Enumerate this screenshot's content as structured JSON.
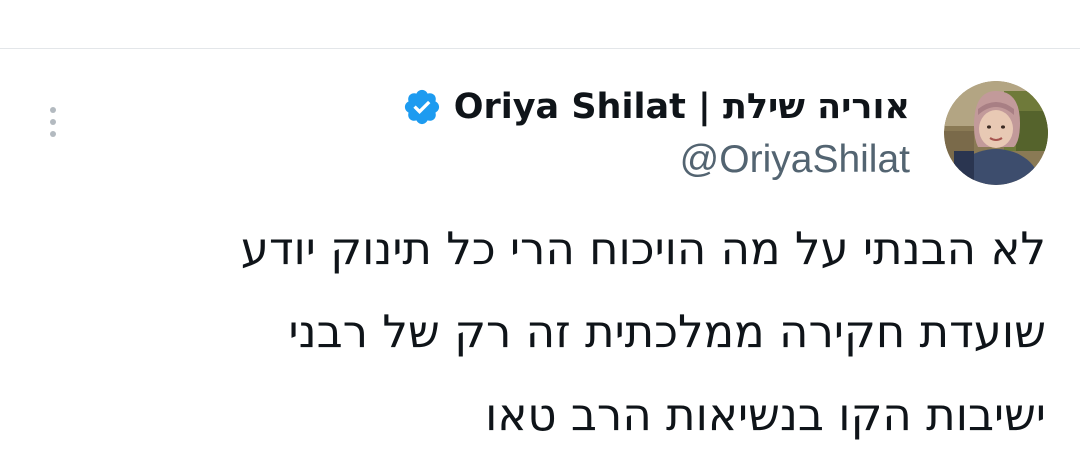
{
  "tweet": {
    "author": {
      "display_name": "אוריה שילת | Oriya Shilat",
      "handle": "@OriyaShilat",
      "verified": true,
      "verified_color": "#1d9bf0",
      "avatar_icon": "profile-photo"
    },
    "text_lines": [
      "לא הבנתי על מה הויכוח הרי כל תינוק יודע",
      "שועדת חקירה ממלכתית זה רק של רבני",
      "ישיבות הקו בנשיאות הרב טאו"
    ],
    "more_icon": "more-vertical-icon"
  },
  "colors": {
    "text_primary": "#0f1419",
    "text_secondary": "#536471",
    "divider": "#e3e6e9"
  }
}
